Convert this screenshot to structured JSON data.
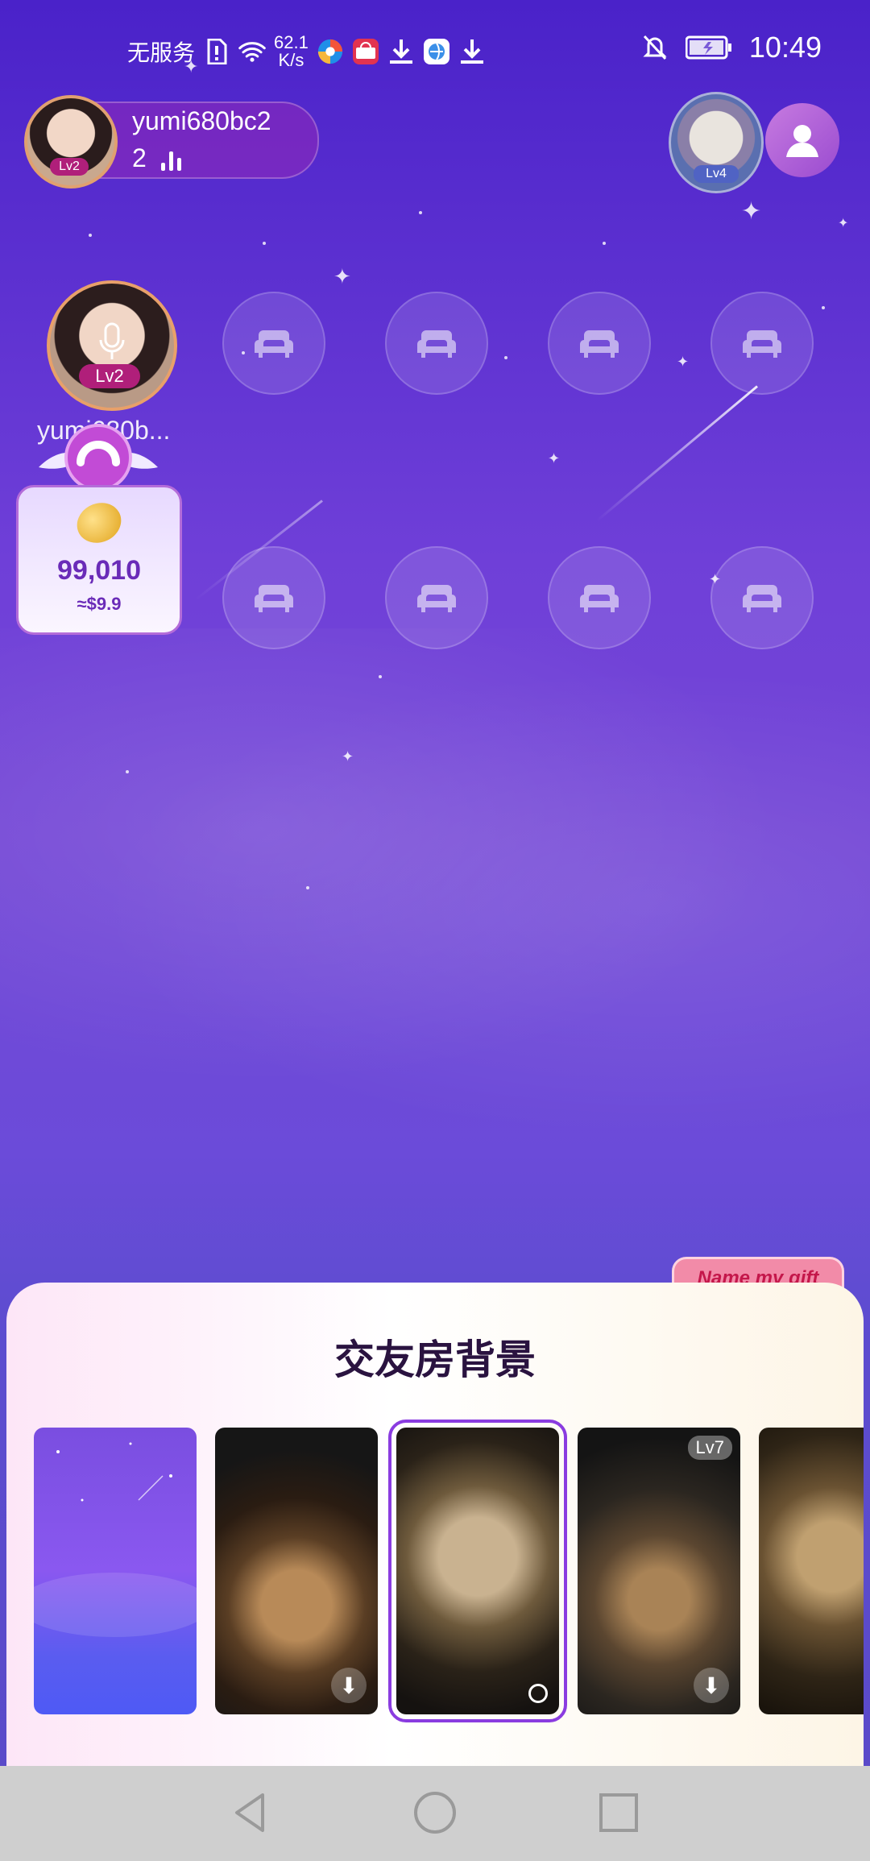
{
  "status_bar": {
    "carrier": "无服务",
    "net_speed_value": "62.1",
    "net_speed_unit": "K/s",
    "time": "10:49",
    "icons": [
      "sim-alert-icon",
      "wifi-icon",
      "browser-icon",
      "huawei-store-icon",
      "download-icon",
      "app-icon",
      "download-icon",
      "bell-off-icon",
      "battery-icon"
    ]
  },
  "owner": {
    "name": "yumi680bc2",
    "count": "2",
    "level": "Lv2"
  },
  "room_badge": {
    "level": "Lv4"
  },
  "host_seat": {
    "name": "yumi680b...",
    "level": "Lv2"
  },
  "gift_card": {
    "amount": "99,010",
    "usd": "≈$9.9"
  },
  "name_gift_button": "Name my gift",
  "sheet": {
    "title": "交友房背景",
    "backgrounds": [
      {
        "name": "purple-sky",
        "state": "current"
      },
      {
        "name": "lion",
        "state": "download"
      },
      {
        "name": "tiger",
        "state": "selected"
      },
      {
        "name": "winged-lion",
        "state": "download",
        "level": "Lv7"
      },
      {
        "name": "eagle",
        "state": "partial"
      }
    ]
  },
  "colors": {
    "accent": "#8a3ce0",
    "badge_pink": "#b01f7a",
    "sheet_title": "#2a1340"
  }
}
